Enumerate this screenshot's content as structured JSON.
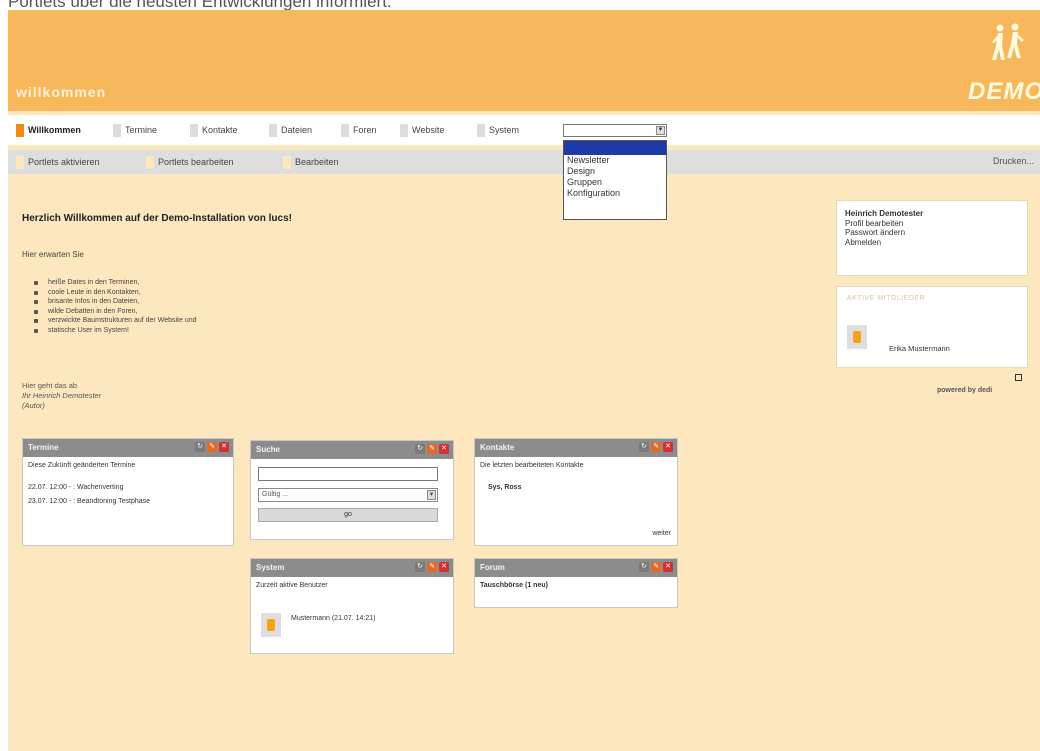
{
  "caption": "Portlets über die neusten Entwicklungen informiert.",
  "header": {
    "welcome": "willkommen",
    "logo_text": "DEMO",
    "brand_color": "#f9b75c"
  },
  "tabs": {
    "items": [
      {
        "label": "Willkommen",
        "active": true
      },
      {
        "label": "Termine"
      },
      {
        "label": "Kontakte"
      },
      {
        "label": "Dateien"
      },
      {
        "label": "Foren"
      },
      {
        "label": "Website"
      },
      {
        "label": "System"
      }
    ],
    "select_value": ""
  },
  "dropdown": {
    "options": [
      "Newsletter",
      "Design",
      "Gruppen",
      "Konfiguration"
    ]
  },
  "subbar": {
    "links": [
      "Portlets aktivieren",
      "Portlets bearbeiten",
      "Bearbeiten"
    ],
    "print": "Drucken..."
  },
  "main": {
    "title": "Herzlich Willkommen auf der Demo-Installation von lucs!",
    "intro": "Hier erwarten Sie",
    "bullets": [
      "heiße Dates in den Terminen,",
      "coole Leute in den Kontakten,",
      "brisante Infos in den Dateien,",
      "wilde Debatten in den Foren,",
      "verzwickte Baumstrukturen auf der Website und",
      "statische User im System!"
    ],
    "sign_1": "Hier geht das ab",
    "sign_2": "Ihr Heinrich Demotester",
    "sign_3": "(Autor)"
  },
  "portlets": {
    "termine": {
      "title": "Termine",
      "text": "Diese Zukünft geänderten Termine",
      "e1": "22.07. 12:00 - : Wachenverting",
      "e2": "23.07. 12:00 - : Beandtoning Testphase"
    },
    "suche": {
      "title": "Suche",
      "select": "Gültig ...",
      "button": "go"
    },
    "kontakte": {
      "title": "Kontakte",
      "text": "Die letzten bearbeiteten Kontakte",
      "name": "Sys, Ross",
      "more": "weiter"
    },
    "system": {
      "title": "System",
      "text": "Zurzeit aktive Benutzer",
      "user": "Mustermann (21.07. 14:21)"
    },
    "forum": {
      "title": "Forum",
      "text": "Tauschbörse (1 neu)"
    }
  },
  "right": {
    "name": "Heinrich Demotester",
    "links": [
      "Profil bearbeiten",
      "Passwort ändern",
      "Abmelden"
    ],
    "members_title": "AKTIVE MITGLIEDER",
    "member": "Erika Mustermann",
    "powered": "powered by dedi"
  }
}
